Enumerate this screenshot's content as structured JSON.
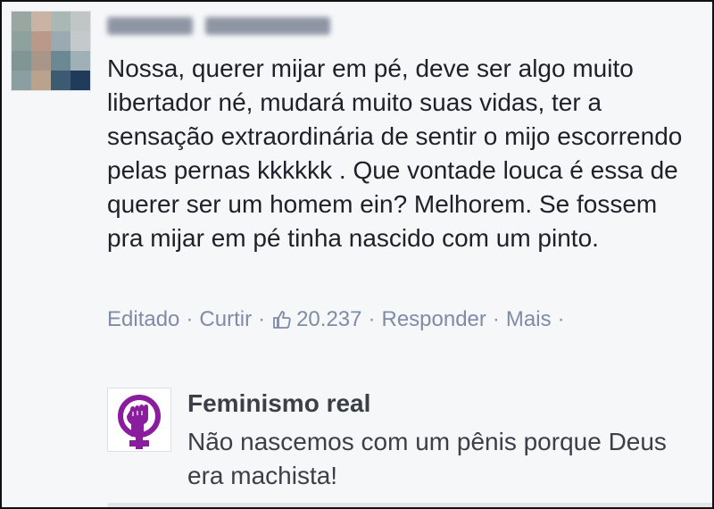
{
  "comment": {
    "author_name": "",
    "text": "Nossa, querer mijar em pé, deve ser algo muito libertador né, mudará muito suas vidas, ter a sensação extraordinária de sentir o mijo escorrendo pelas pernas kkkkkk . Que vontade louca é essa de querer ser um homem ein? Melhorem. Se fossem pra mijar em pé tinha nascido com um pinto."
  },
  "actions": {
    "edited_label": "Editado",
    "like_label": "Curtir",
    "like_icon": "thumbs-up-icon",
    "like_count": "20.237",
    "reply_label": "Responder",
    "more_label": "Mais",
    "separator": "·"
  },
  "reply_preview": {
    "page_name": "Feminismo real",
    "page_logo": "feminist-fist-venus-icon",
    "text": "Não nascemos com um pênis porque Deus era machista!"
  },
  "colors": {
    "background": "#f6f7f9",
    "link": "#7e8ca6",
    "text": "#1d2129",
    "logo_purple": "#8a1d9e"
  }
}
